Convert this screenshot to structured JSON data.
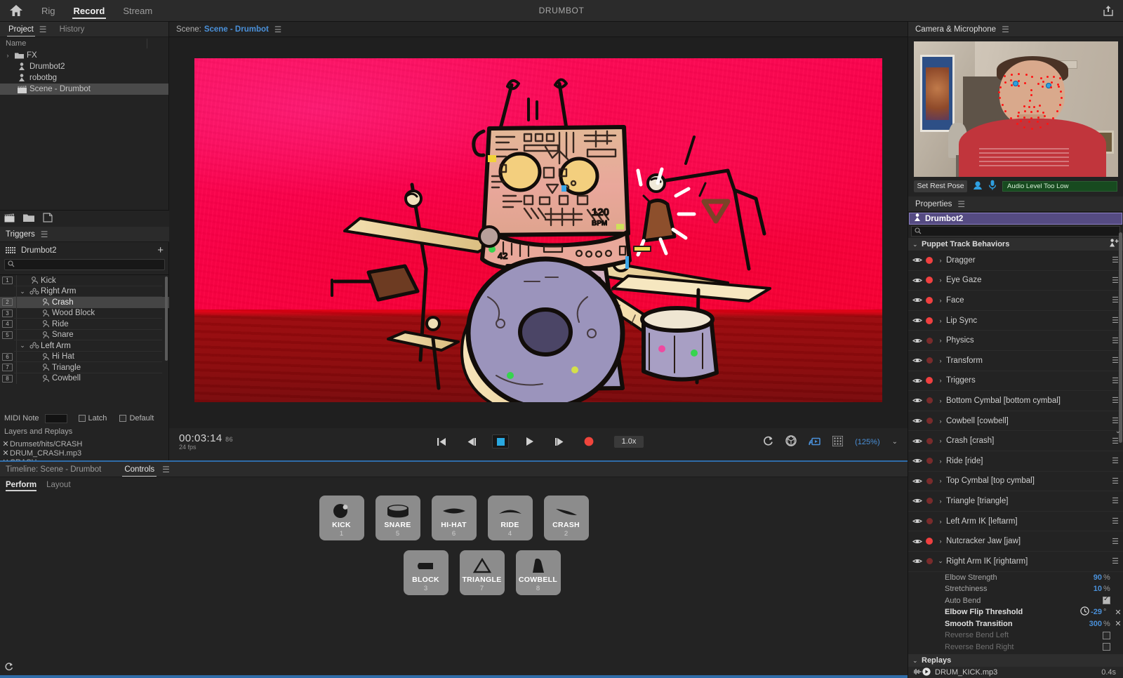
{
  "app": {
    "document_title": "DRUMBOT",
    "nav_tabs": [
      {
        "label": "Rig",
        "active": false
      },
      {
        "label": "Record",
        "active": true
      },
      {
        "label": "Stream",
        "active": false
      }
    ],
    "home_icon": "home-icon",
    "share_icon": "share-icon"
  },
  "project_panel": {
    "tabs": [
      {
        "label": "Project",
        "active": true
      },
      {
        "label": "History",
        "active": false
      }
    ],
    "menu_icon": "hamburger-menu-icon",
    "column_header": "Name",
    "items": [
      {
        "label": "FX",
        "icon": "folder-icon",
        "twirl": "›",
        "indent": 0,
        "selected": false
      },
      {
        "label": "Drumbot2",
        "icon": "puppet-icon",
        "indent": 1,
        "selected": false
      },
      {
        "label": "robotbg",
        "icon": "puppet-icon",
        "indent": 1,
        "selected": false
      },
      {
        "label": "Scene - Drumbot",
        "icon": "scene-clapboard-icon",
        "indent": 1,
        "selected": true
      }
    ],
    "footer_icons": [
      "new-scene-icon",
      "new-folder-icon",
      "new-item-icon"
    ]
  },
  "triggers_panel": {
    "title": "Triggers",
    "menu_icon": "hamburger-menu-icon",
    "puppet_name": "Drumbot2",
    "grid_icon": "keyboard-grid-icon",
    "add_icon": "plus-icon",
    "search_placeholder": "",
    "search_value": "",
    "rows": [
      {
        "num": "1",
        "label": "Kick",
        "type": "trigger",
        "indent": 1,
        "selected": false
      },
      {
        "num": "",
        "label": "Right Arm",
        "type": "group",
        "indent": 0,
        "caret": "⌄",
        "selected": false
      },
      {
        "num": "2",
        "label": "Crash",
        "type": "trigger",
        "indent": 2,
        "selected": true
      },
      {
        "num": "3",
        "label": "Wood Block",
        "type": "trigger",
        "indent": 2,
        "selected": false
      },
      {
        "num": "4",
        "label": "Ride",
        "type": "trigger",
        "indent": 2,
        "selected": false
      },
      {
        "num": "5",
        "label": "Snare",
        "type": "trigger",
        "indent": 2,
        "selected": false
      },
      {
        "num": "",
        "label": "Left Arm",
        "type": "group",
        "indent": 0,
        "caret": "⌄",
        "selected": false
      },
      {
        "num": "6",
        "label": "Hi Hat",
        "type": "trigger",
        "indent": 2,
        "selected": false
      },
      {
        "num": "7",
        "label": "Triangle",
        "type": "trigger",
        "indent": 2,
        "selected": false
      },
      {
        "num": "8",
        "label": "Cowbell",
        "type": "trigger",
        "indent": 2,
        "selected": false
      }
    ],
    "midi_note_label": "MIDI Note",
    "midi_note_value": "",
    "latch_label": "Latch",
    "latch_checked": false,
    "default_label": "Default",
    "default_checked": false,
    "layers_title": "Layers and Replays",
    "layers": [
      {
        "label": "Drumset/hits/CRASH"
      },
      {
        "label": "DRUM_CRASH.mp3"
      },
      {
        "label": "CRASH"
      }
    ]
  },
  "scene_bar": {
    "prefix": "Scene:",
    "name": "Scene - Drumbot",
    "menu_icon": "hamburger-menu-icon"
  },
  "transport": {
    "timecode": "00:03:14",
    "subframe": "86",
    "fps": "24 fps",
    "buttons": [
      {
        "name": "go-to-start-button",
        "glyph": "skip-back-icon"
      },
      {
        "name": "step-back-button",
        "glyph": "step-back-icon"
      },
      {
        "name": "stop-button",
        "glyph": "stop-icon",
        "active": true
      },
      {
        "name": "play-button",
        "glyph": "play-icon"
      },
      {
        "name": "step-forward-button",
        "glyph": "step-forward-icon"
      },
      {
        "name": "record-button",
        "glyph": "record-icon"
      }
    ],
    "rate": "1.0x",
    "right_icons": [
      "reload-icon",
      "camera-input-icon",
      "stream-icon",
      "grid-icon"
    ],
    "zoom": "(125%)",
    "zoom_dropdown": "⌄"
  },
  "bottom_panel": {
    "timeline_label": "Timeline: Scene - Drumbot",
    "controls_tab": "Controls",
    "controls_menu_icon": "hamburger-menu-icon",
    "subtabs": [
      {
        "label": "Perform",
        "active": true
      },
      {
        "label": "Layout",
        "active": false
      }
    ],
    "refresh_icon": "refresh-icon",
    "pads_row1": [
      {
        "name": "KICK",
        "num": "1",
        "glyph": "kick-drum-icon"
      },
      {
        "name": "SNARE",
        "num": "5",
        "glyph": "snare-drum-icon"
      },
      {
        "name": "HI-HAT",
        "num": "6",
        "glyph": "hihat-icon"
      },
      {
        "name": "RIDE",
        "num": "4",
        "glyph": "ride-cymbal-icon"
      },
      {
        "name": "CRASH",
        "num": "2",
        "glyph": "crash-cymbal-icon"
      }
    ],
    "pads_row2": [
      {
        "name": "BLOCK",
        "num": "3",
        "glyph": "wood-block-icon"
      },
      {
        "name": "TRIANGLE",
        "num": "7",
        "glyph": "triangle-icon"
      },
      {
        "name": "COWBELL",
        "num": "8",
        "glyph": "cowbell-icon"
      }
    ]
  },
  "camera_panel": {
    "title": "Camera & Microphone",
    "menu_icon": "hamburger-menu-icon",
    "set_rest_pose": "Set Rest Pose",
    "camera_icon": "webcam-icon",
    "mic_icon": "microphone-icon",
    "audio_status": "Audio Level Too Low"
  },
  "properties_panel": {
    "title": "Properties",
    "menu_icon": "hamburger-menu-icon",
    "puppet_name": "Drumbot2",
    "puppet_icon": "puppet-icon",
    "search_value": "",
    "section_title": "Puppet Track Behaviors",
    "section_add_icon": "add-behavior-icon",
    "behaviors": [
      {
        "label": "Dragger",
        "armed": true,
        "expanded": false
      },
      {
        "label": "Eye Gaze",
        "armed": true,
        "expanded": false
      },
      {
        "label": "Face",
        "armed": true,
        "expanded": false
      },
      {
        "label": "Lip Sync",
        "armed": true,
        "expanded": false
      },
      {
        "label": "Physics",
        "armed": false,
        "expanded": false
      },
      {
        "label": "Transform",
        "armed": false,
        "expanded": false
      },
      {
        "label": "Triggers",
        "armed": true,
        "expanded": false
      },
      {
        "label": "Bottom Cymbal [bottom cymbal]",
        "armed": false,
        "expanded": false
      },
      {
        "label": "Cowbell [cowbell]",
        "armed": false,
        "expanded": false
      },
      {
        "label": "Crash [crash]",
        "armed": false,
        "expanded": false
      },
      {
        "label": "Ride [ride]",
        "armed": false,
        "expanded": false
      },
      {
        "label": "Top Cymbal [top cymbal]",
        "armed": false,
        "expanded": false
      },
      {
        "label": "Triangle [triangle]",
        "armed": false,
        "expanded": false
      },
      {
        "label": "Left Arm IK [leftarm]",
        "armed": false,
        "expanded": false
      },
      {
        "label": "Nutcracker Jaw [jaw]",
        "armed": true,
        "expanded": false
      },
      {
        "label": "Right Arm IK [rightarm]",
        "armed": false,
        "expanded": true
      }
    ],
    "rightarm_props": [
      {
        "label": "Elbow Strength",
        "value": "90",
        "unit": "%",
        "kind": "value",
        "bold": false,
        "dim": false
      },
      {
        "label": "Stretchiness",
        "value": "10",
        "unit": "%",
        "kind": "value",
        "bold": false,
        "dim": false
      },
      {
        "label": "Auto Bend",
        "value": "",
        "unit": "",
        "kind": "checkbox-on",
        "bold": false,
        "dim": false
      },
      {
        "label": "Elbow Flip Threshold",
        "value": "-29",
        "unit": "°",
        "kind": "value-clock-x",
        "bold": true,
        "dim": false
      },
      {
        "label": "Smooth Transition",
        "value": "300",
        "unit": "%",
        "kind": "value-x",
        "bold": true,
        "dim": false
      },
      {
        "label": "Reverse Bend Left",
        "value": "",
        "unit": "",
        "kind": "checkbox-off",
        "bold": false,
        "dim": true
      },
      {
        "label": "Reverse Bend Right",
        "value": "",
        "unit": "",
        "kind": "checkbox-off",
        "bold": false,
        "dim": true
      }
    ],
    "replays_title": "Replays",
    "replays": [
      {
        "label": "DRUM_KICK.mp3",
        "duration": "0.4s",
        "wave_icon": "waveform-icon",
        "play_icon": "play-circle-icon"
      }
    ]
  },
  "colors": {
    "accent_blue": "#4a90d9",
    "panel_bg": "#232323",
    "header_bg": "#2b2b2b",
    "selection_purple": "#554b82",
    "record_red": "#f04040",
    "stage_pink": "#ff0f5e",
    "stage_floor": "#8c0a0c",
    "audio_ok_green": "#174a1f"
  }
}
